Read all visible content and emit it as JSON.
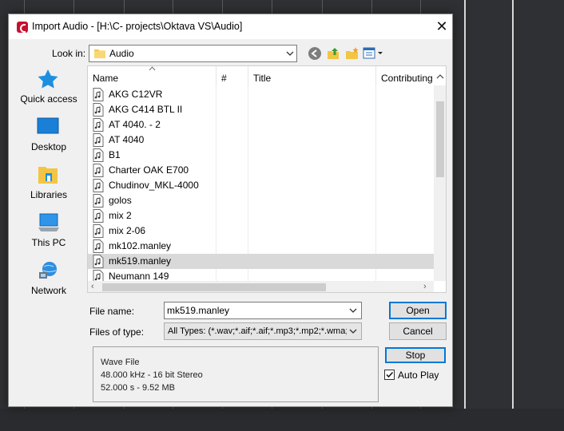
{
  "dialog": {
    "title": "Import Audio - [H:\\C- projects\\Oktava VS\\Audio]",
    "close_glyph": "✕"
  },
  "lookin": {
    "label": "Look in:",
    "value": "Audio"
  },
  "places": [
    {
      "label": "Quick access",
      "icon": "star-icon"
    },
    {
      "label": "Desktop",
      "icon": "desktop-icon"
    },
    {
      "label": "Libraries",
      "icon": "libraries-icon"
    },
    {
      "label": "This PC",
      "icon": "computer-icon"
    },
    {
      "label": "Network",
      "icon": "network-icon"
    }
  ],
  "columns": [
    "Name",
    "#",
    "Title",
    "Contributing"
  ],
  "files": [
    "AKG C12VR",
    "AKG C414 BTL II",
    "AT 4040. - 2",
    "AT 4040",
    "B1",
    "Charter OAK E700",
    "Chudinov_MKL-4000",
    "golos",
    "mix 2",
    "mix 2-06",
    "mk102.manley",
    "mk519.manley",
    "Neumann 149"
  ],
  "selected_file": "mk519.manley",
  "filename": {
    "label": "File name:",
    "value": "mk519.manley"
  },
  "filetype": {
    "label": "Files of type:",
    "value": "All Types: (*.wav;*.aif;*.aif;*.mp3;*.mp2;*.wma;*."
  },
  "buttons": {
    "open": "Open",
    "cancel": "Cancel",
    "stop": "Stop"
  },
  "info": {
    "format": "Wave File",
    "specs": "48.000 kHz - 16 bit Stereo",
    "duration_size": "52.000 s - 9.52 MB"
  },
  "autoplay": {
    "label": "Auto Play",
    "checked": true
  },
  "colors": {
    "accent": "#0078d7",
    "selected_row": "#d9d9d9",
    "app_icon": "#c8102e"
  }
}
